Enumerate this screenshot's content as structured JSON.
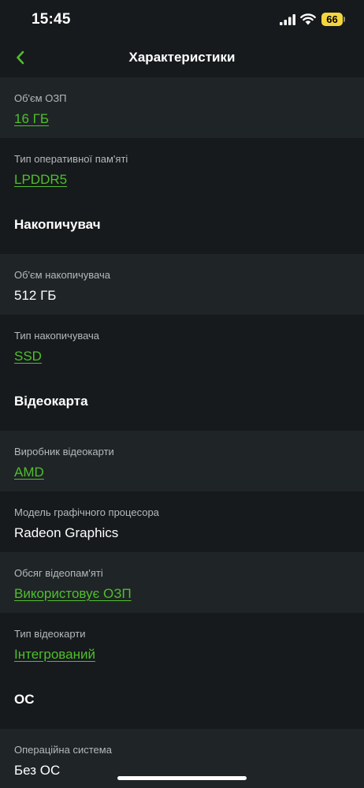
{
  "status_bar": {
    "time": "15:45",
    "battery": "66",
    "battery_color": "#f4d63c"
  },
  "nav": {
    "title": "Характеристики",
    "accent": "#4fbf2b"
  },
  "rows": [
    {
      "label": "Об'єм ОЗП",
      "value": "16 ГБ",
      "link": true
    },
    {
      "label": "Тип оперативної пам'яті",
      "value": "LPDDR5",
      "link": true
    }
  ],
  "storage": {
    "title": "Накопичувач",
    "rows": [
      {
        "label": "Об'єм накопичувача",
        "value": "512 ГБ",
        "link": false
      },
      {
        "label": "Тип накопичувача",
        "value": "SSD",
        "link": true
      }
    ]
  },
  "gpu": {
    "title": "Відеокарта",
    "rows": [
      {
        "label": "Виробник відеокарти",
        "value": "AMD",
        "link": true
      },
      {
        "label": "Модель графічного процесора",
        "value": "Radeon Graphics",
        "link": false
      },
      {
        "label": "Обсяг відеопам'яті",
        "value": "Використовує ОЗП",
        "link": true
      },
      {
        "label": "Тип відеокарти",
        "value": "Інтегрований",
        "link": true
      }
    ]
  },
  "os": {
    "title": "ОС",
    "rows": [
      {
        "label": "Операційна система",
        "value": "Без ОС",
        "link": false
      }
    ]
  }
}
